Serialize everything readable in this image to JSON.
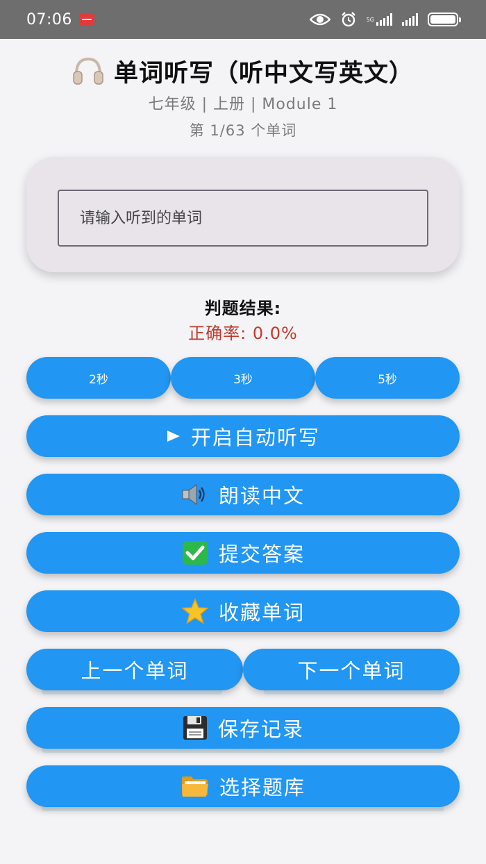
{
  "status_bar": {
    "time": "07:06",
    "network_label": "5G",
    "icons": [
      "notification-icon",
      "eye-icon",
      "alarm-icon",
      "signal-icon",
      "battery-icon"
    ]
  },
  "header": {
    "icon": "headphones-icon",
    "title": "单词听写（听中文写英文）",
    "subtitle": "七年级 | 上册 | Module 1",
    "progress": "第 1/63 个单词"
  },
  "input": {
    "placeholder": "请输入听到的单词",
    "value": ""
  },
  "result": {
    "label": "判题结果:",
    "accuracy": "正确率: 0.0%"
  },
  "interval_buttons": [
    {
      "label": "2秒"
    },
    {
      "label": "3秒"
    },
    {
      "label": "5秒"
    }
  ],
  "actions": {
    "auto_dictation": {
      "icon": "play-icon",
      "label": "开启自动听写"
    },
    "read_chinese": {
      "icon": "speaker-icon",
      "label": "朗读中文"
    },
    "submit": {
      "icon": "check-icon",
      "label": "提交答案"
    },
    "favorite": {
      "icon": "star-icon",
      "label": "收藏单词"
    },
    "prev_word": {
      "label": "上一个单词"
    },
    "next_word": {
      "label": "下一个单词"
    },
    "save_record": {
      "icon": "floppy-disk-icon",
      "label": "保存记录"
    },
    "choose_bank": {
      "icon": "folder-icon",
      "label": "选择题库"
    }
  },
  "colors": {
    "primary": "#2196f3",
    "accuracy": "#c0392b",
    "card": "#e8e4ea"
  }
}
